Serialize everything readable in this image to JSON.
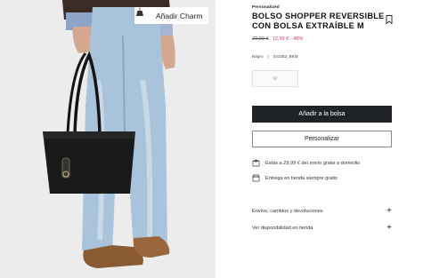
{
  "image": {
    "charm_button_label": "Añadir Charm",
    "charm_icon": "shopping-bag-charm-icon"
  },
  "product": {
    "tag": "Personalized",
    "title_line1": "BOLSO SHOPPER REVERSIBLE",
    "title_line2": "CON BOLSA EXTRAÍBLE M",
    "price_old": "29,99 €",
    "price_new": "12,99 € - 48%",
    "color_name": "Negro",
    "separator": "|",
    "ref": "242353_BKM",
    "size_label": "M",
    "bookmark_icon": "bookmark-icon"
  },
  "actions": {
    "add_to_bag": "Añadir a la bolsa",
    "customize": "Personalizar"
  },
  "shipping": {
    "prefix": "Estás a ",
    "amount": "29,99 €",
    "suffix": " del envío gratis a domicilio",
    "store": "Entrega en tienda siempre gratis"
  },
  "accordion": {
    "returns": "Envíos, cambios y devoluciones",
    "availability": "Ver disponibilidad en tienda",
    "expand_symbol": "+"
  },
  "colors": {
    "primary_button": "#1f2226",
    "sale": "#d3385c",
    "image_bg": "#ececec"
  }
}
